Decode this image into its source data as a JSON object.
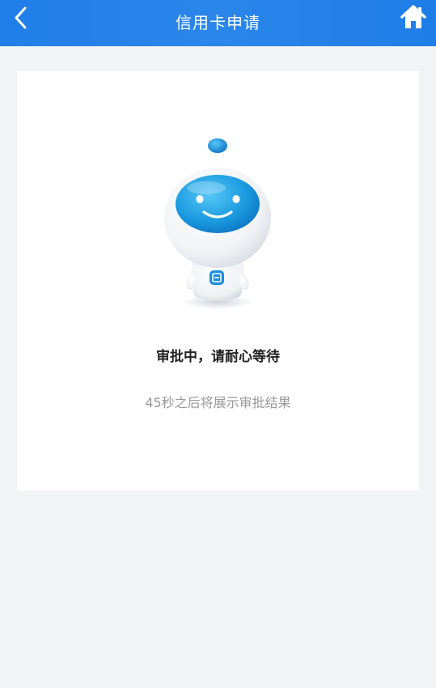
{
  "header": {
    "title": "信用卡申请",
    "back_icon": "chevron-left-icon",
    "home_icon": "home-icon",
    "color": "#1f7ee8"
  },
  "status": {
    "title": "审批中，请耐心等待",
    "subtitle": "45秒之后将展示审批结果",
    "mascot": "robot-mascot-icon"
  }
}
